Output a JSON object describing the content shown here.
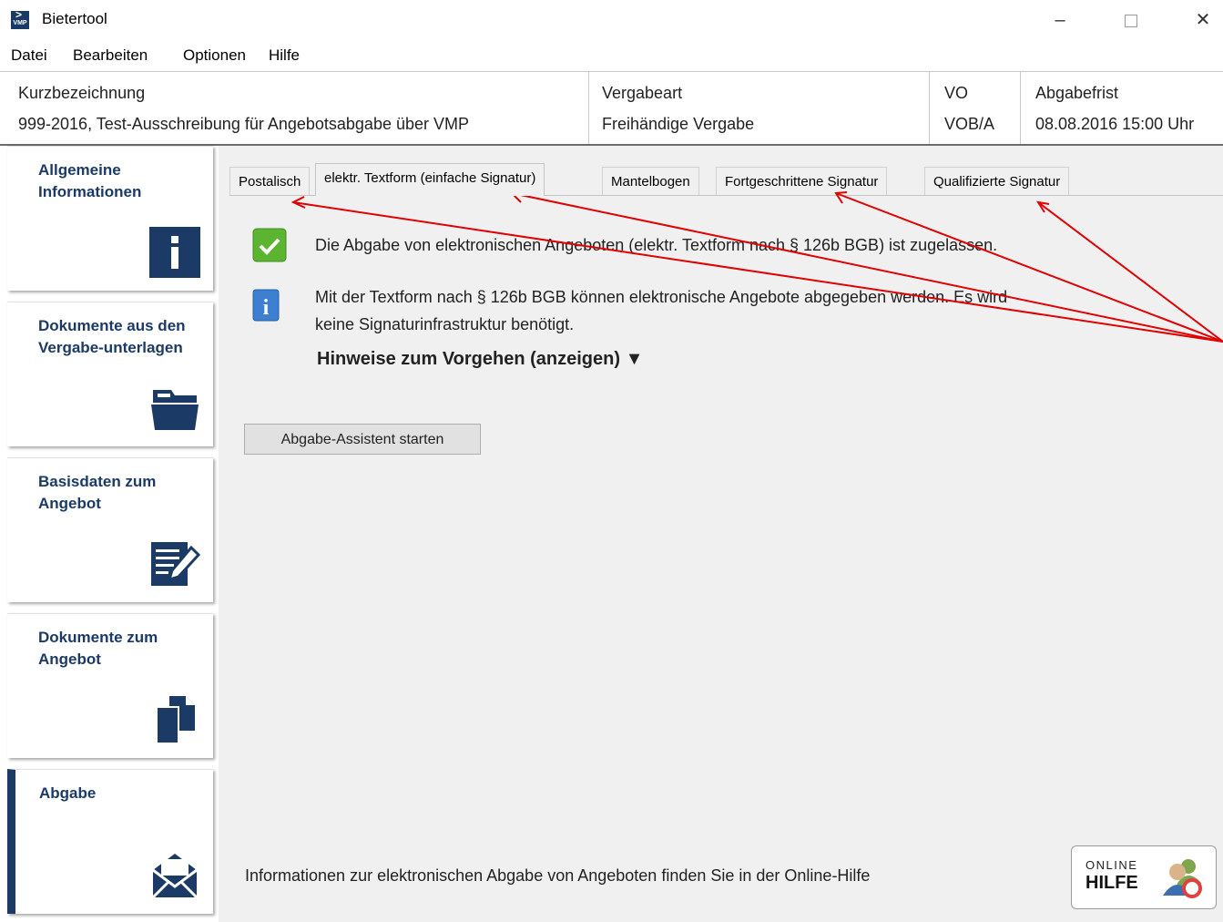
{
  "window": {
    "title": "Bietertool",
    "logo_text": "VMP"
  },
  "menu": [
    "Datei",
    "Bearbeiten",
    "Optionen",
    "Hilfe"
  ],
  "info": {
    "kurz_label": "Kurzbezeichnung",
    "kurz_value": "999-2016, Test-Ausschreibung für Angebotsabgabe über VMP",
    "vergabeart_label": "Vergabeart",
    "vergabeart_value": "Freihändige Vergabe",
    "vo_label": "VO",
    "vo_value": "VOB/A",
    "frist_label": "Abgabefrist",
    "frist_value": "08.08.2016 15:00 Uhr"
  },
  "sidebar": [
    {
      "label": "Allgemeine Informationen",
      "icon": "info-icon"
    },
    {
      "label": "Dokumente aus den Vergabe-unterlagen",
      "icon": "folder-icon"
    },
    {
      "label": "Basisdaten zum Angebot",
      "icon": "edit-form-icon"
    },
    {
      "label": "Dokumente zum Angebot",
      "icon": "documents-icon"
    },
    {
      "label": "Abgabe",
      "icon": "envelope-icon",
      "active": true
    }
  ],
  "tabs": [
    "Postalisch",
    "elektr. Textform (einfache Signatur)",
    "Mantelbogen",
    "Fortgeschrittene Signatur",
    "Qualifizierte Signatur"
  ],
  "active_tab": 1,
  "messages": {
    "success": "Die Abgabe von elektronischen Angeboten (elektr. Textform nach § 126b BGB) ist zugelassen.",
    "info_line1": "Mit der Textform nach § 126b BGB können elektronische Angebote abgegeben werden. Es wird",
    "info_line2": "keine Signaturinfrastruktur benötigt."
  },
  "hint_toggle": "Hinweise zum Vorgehen (anzeigen) ▼",
  "start_button": "Abgabe-Assistent starten",
  "footer_text": "Informationen zur elektronischen Abgabe von Angeboten finden Sie in der Online-Hilfe",
  "help_button": {
    "line1": "ONLINE",
    "line2": "HILFE"
  },
  "colors": {
    "nav_text": "#1b3a66",
    "accent_navy": "#1b3a66",
    "check_green": "#5cb531",
    "info_blue": "#3d7fd1",
    "annotation_red": "#e00000"
  }
}
